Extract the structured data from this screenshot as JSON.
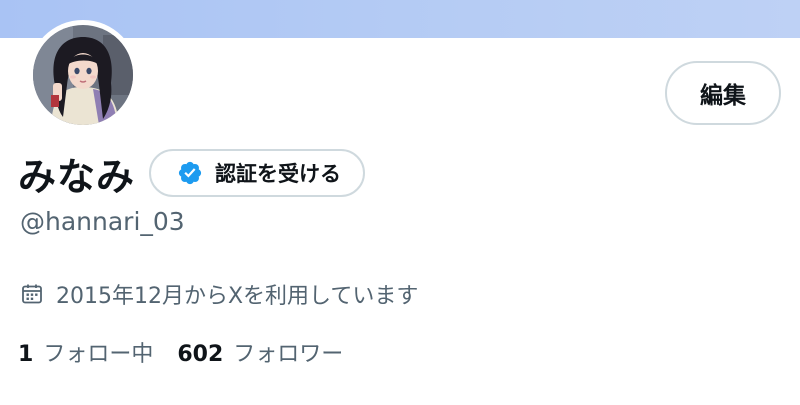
{
  "profile": {
    "display_name": "みなみ",
    "handle": "@hannari_03",
    "edit_label": "編集",
    "verify_label": "認証を受ける",
    "joined_text": "2015年12月からXを利用しています"
  },
  "stats": {
    "following_count": "1",
    "following_label": "フォロー中",
    "followers_count": "602",
    "followers_label": "フォロワー"
  },
  "icons": {
    "verify": "verified-badge-icon",
    "calendar": "calendar-icon",
    "avatar": "avatar"
  },
  "colors": {
    "banner": "#b4cbf4",
    "verified_blue": "#1d9bf0",
    "secondary_text": "#536471",
    "border": "#cfd9de"
  }
}
